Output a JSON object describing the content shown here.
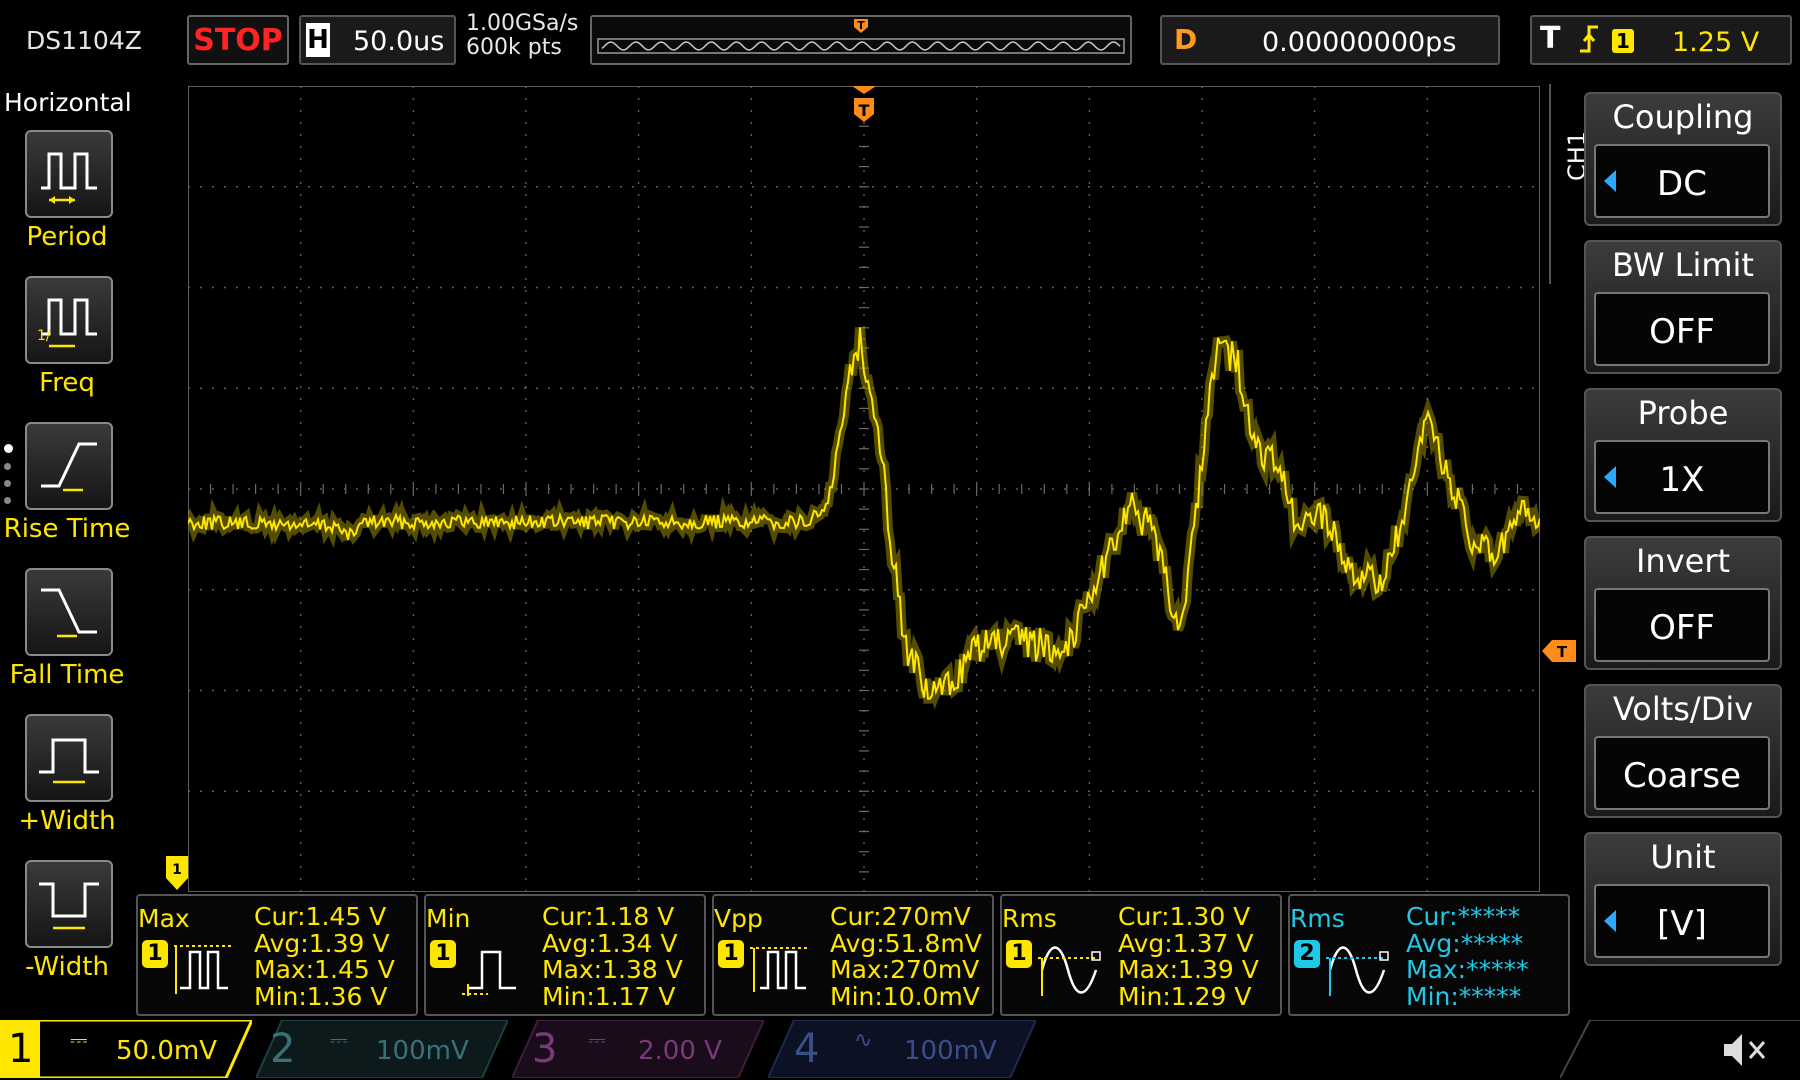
{
  "topbar": {
    "model": "DS1104Z",
    "run_state": "STOP",
    "timebase_label": "H",
    "timebase_value": "50.0us",
    "sample_rate": "1.00GSa/s",
    "memory_depth": "600k pts",
    "delay_label": "D",
    "delay_value": "0.00000000ps",
    "trigger_label": "T",
    "trigger_source": "1",
    "trigger_level": "1.25 V"
  },
  "left_menu": {
    "title": "Horizontal",
    "items": [
      {
        "label": "Period",
        "icon": "period-icon"
      },
      {
        "label": "Freq",
        "icon": "freq-icon"
      },
      {
        "label": "Rise Time",
        "icon": "rise-time-icon"
      },
      {
        "label": "Fall Time",
        "icon": "fall-time-icon"
      },
      {
        "label": "+Width",
        "icon": "positive-width-icon"
      },
      {
        "label": "-Width",
        "icon": "negative-width-icon"
      }
    ]
  },
  "right_menu": {
    "channel_tab": "CH1",
    "items": [
      {
        "label": "Coupling",
        "value": "DC",
        "arrow": true
      },
      {
        "label": "BW Limit",
        "value": "OFF",
        "arrow": false
      },
      {
        "label": "Probe",
        "value": "1X",
        "arrow": true
      },
      {
        "label": "Invert",
        "value": "OFF",
        "arrow": false
      },
      {
        "label": "Volts/Div",
        "value": "Coarse",
        "arrow": false
      },
      {
        "label": "Unit",
        "value": "[V]",
        "arrow": true
      }
    ]
  },
  "measurements": [
    {
      "name": "Max",
      "channel": "1",
      "color": "#ffe600",
      "cur": "Cur:1.45 V",
      "avg": "Avg:1.39 V",
      "max": "Max:1.45 V",
      "min": "Min:1.36 V"
    },
    {
      "name": "Min",
      "channel": "1",
      "color": "#ffe600",
      "cur": "Cur:1.18 V",
      "avg": "Avg:1.34 V",
      "max": "Max:1.38 V",
      "min": "Min:1.17 V"
    },
    {
      "name": "Vpp",
      "channel": "1",
      "color": "#ffe600",
      "cur": "Cur:270mV",
      "avg": "Avg:51.8mV",
      "max": "Max:270mV",
      "min": "Min:10.0mV"
    },
    {
      "name": "Rms",
      "channel": "1",
      "color": "#ffe600",
      "cur": "Cur:1.30 V",
      "avg": "Avg:1.37 V",
      "max": "Max:1.39 V",
      "min": "Min:1.29 V"
    },
    {
      "name": "Rms",
      "channel": "2",
      "color": "#20c8e8",
      "cur": "Cur:*****",
      "avg": "Avg:*****",
      "max": "Max:*****",
      "min": "Min:*****"
    }
  ],
  "channels": [
    {
      "num": "1",
      "coupling": "DC",
      "scale": "50.0mV",
      "color": "#ffe600",
      "active": true
    },
    {
      "num": "2",
      "coupling": "DC",
      "scale": "100mV",
      "color": "#20c8e8",
      "active": false
    },
    {
      "num": "3",
      "coupling": "DC",
      "scale": "2.00 V",
      "color": "#d040d0",
      "active": false
    },
    {
      "num": "4",
      "coupling": "AC",
      "scale": "100mV",
      "color": "#3a6cff",
      "active": false
    }
  ],
  "colors": {
    "trace": "#ffe600",
    "trigger": "#ff8c1a",
    "stop": "#ff2323"
  }
}
